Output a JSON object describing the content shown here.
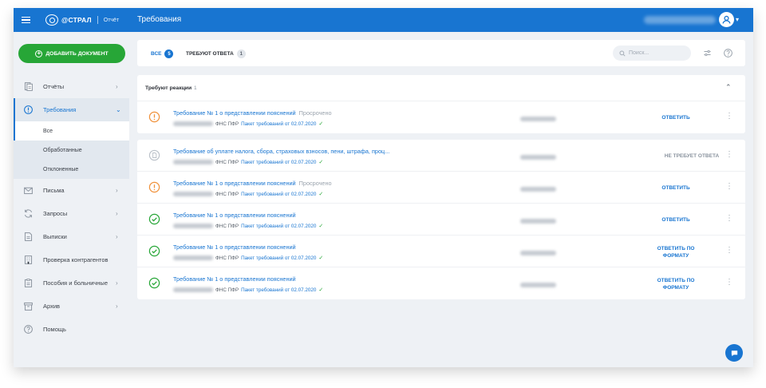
{
  "header": {
    "logo_text": "@СТРАЛ",
    "logo_sub": "Отчёт",
    "title": "Требования"
  },
  "sidebar": {
    "add_button": "ДОБАВИТЬ ДОКУМЕНТ",
    "items": [
      {
        "label": "Отчёты",
        "icon": "reports-icon",
        "has_chevron": true
      },
      {
        "label": "Требования",
        "icon": "alert-circle-icon",
        "has_chevron": true,
        "active": true
      },
      {
        "label": "Письма",
        "icon": "mail-icon",
        "has_chevron": true
      },
      {
        "label": "Запросы",
        "icon": "refresh-icon",
        "has_chevron": true
      },
      {
        "label": "Выписки",
        "icon": "statement-icon",
        "has_chevron": true
      },
      {
        "label": "Проверка контрагентов",
        "icon": "building-icon",
        "has_chevron": false
      },
      {
        "label": "Пособия и больничные",
        "icon": "clipboard-icon",
        "has_chevron": true
      },
      {
        "label": "Архив",
        "icon": "archive-icon",
        "has_chevron": true
      },
      {
        "label": "Помощь",
        "icon": "help-icon",
        "has_chevron": false
      }
    ],
    "subitems": [
      {
        "label": "Все",
        "selected": true
      },
      {
        "label": "Обработанные"
      },
      {
        "label": "Отклоненные"
      }
    ]
  },
  "filters": {
    "tabs": [
      {
        "label": "ВСЕ",
        "count": "5",
        "active": true
      },
      {
        "label": "ТРЕБУЮТ ОТВЕТА",
        "count": "1"
      }
    ],
    "search_placeholder": "Поиск..."
  },
  "reaction_section": {
    "title": "Требуют реакции",
    "count": "1",
    "rows": [
      {
        "status": "warning",
        "title": "Требование № 1 о представлении пояснений",
        "note": "Просрочено",
        "sender": "ФНС ПФР",
        "package": "Пакет требований от 02.07.2020",
        "action": "ОТВЕТИТЬ"
      }
    ]
  },
  "list_section": {
    "rows": [
      {
        "status": "pending",
        "title": "Требование об уплате налога, сбора, страховых взносов, пени, штрафа, проц...",
        "note": "",
        "sender": "ФНС ПФР",
        "package": "Пакет требований от 02.07.2020",
        "action": "НЕ ТРЕБУЕТ ОТВЕТА",
        "action_muted": true
      },
      {
        "status": "warning",
        "title": "Требование № 1 о представлении пояснений",
        "note": "Просрочено",
        "sender": "ФНС ПФР",
        "package": "Пакет требований от 02.07.2020",
        "action": "ОТВЕТИТЬ"
      },
      {
        "status": "done",
        "title": "Требование № 1 о представлении пояснений",
        "note": "",
        "sender": "ФНС ПФР",
        "package": "Пакет требований от 02.07.2020",
        "action": "ОТВЕТИТЬ"
      },
      {
        "status": "done",
        "title": "Требование № 1 о представлении пояснений",
        "note": "",
        "sender": "ФНС ПФР",
        "package": "Пакет требований от 02.07.2020",
        "action": "ОТВЕТИТЬ ПО ФОРМАТУ"
      },
      {
        "status": "done",
        "title": "Требование № 1 о представлении пояснений",
        "note": "",
        "sender": "ФНС ПФР",
        "package": "Пакет требований от 02.07.2020",
        "action": "ОТВЕТИТЬ ПО ФОРМАТУ"
      }
    ]
  },
  "colors": {
    "primary": "#1875d1",
    "green": "#27a637",
    "warning": "#f0913a",
    "background": "#eef1f5"
  }
}
